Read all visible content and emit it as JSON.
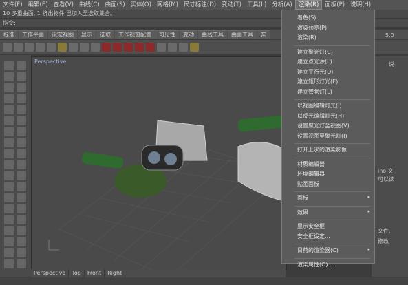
{
  "menubar": {
    "items": [
      {
        "label": "文件(F)"
      },
      {
        "label": "编辑(E)"
      },
      {
        "label": "查看(V)"
      },
      {
        "label": "曲线(C)"
      },
      {
        "label": "曲面(S)"
      },
      {
        "label": "实体(O)"
      },
      {
        "label": "网格(M)"
      },
      {
        "label": "尺寸标注(D)"
      },
      {
        "label": "变动(T)"
      },
      {
        "label": "工具(L)"
      },
      {
        "label": "分析(A)"
      },
      {
        "label": "渲染(R)",
        "active": true
      },
      {
        "label": "面板(P)"
      },
      {
        "label": "说明(H)"
      }
    ]
  },
  "command_history": "10 多重曲面, 1 挤出物件 已加入至选取集合。",
  "command_prompt": "指令:",
  "toolbar_tabs": [
    "标准",
    "工作平面",
    "设定视图",
    "显示",
    "选取",
    "工作视窗配置",
    "可见性",
    "变动",
    "曲线工具",
    "曲面工具",
    "实"
  ],
  "viewport": {
    "label": "Perspective"
  },
  "viewport_tabs": [
    "Perspective",
    "Top",
    "Front",
    "Right"
  ],
  "right_panel": {
    "tab_fragment": "说",
    "text_fragments": [
      "ino 文",
      "可以读",
      "文件,",
      "修改"
    ],
    "zoom": "5.0"
  },
  "render_menu": {
    "items": [
      {
        "label": "着色(S)"
      },
      {
        "label": "渲染预览(P)"
      },
      {
        "label": "渲染(R)"
      },
      {
        "separator": true
      },
      {
        "label": "建立聚光灯(C)"
      },
      {
        "label": "建立点光源(L)"
      },
      {
        "label": "建立平行光(D)"
      },
      {
        "label": "建立矩形灯光(E)"
      },
      {
        "label": "建立管状灯(L)"
      },
      {
        "separator": true
      },
      {
        "label": "以视图编辑灯光(I)"
      },
      {
        "label": "以反光编辑灯光(H)"
      },
      {
        "label": "设置聚光灯至视图(V)"
      },
      {
        "label": "设置视图至聚光灯(I)"
      },
      {
        "separator": true
      },
      {
        "label": "打开上次的渲染影像"
      },
      {
        "separator": true
      },
      {
        "label": "材质编辑器"
      },
      {
        "label": "环境编辑器"
      },
      {
        "label": "贴图面板"
      },
      {
        "separator": true
      },
      {
        "label": "面板",
        "submenu": true
      },
      {
        "separator": true
      },
      {
        "label": "效果",
        "submenu": true
      },
      {
        "separator": true
      },
      {
        "label": "显示安全框"
      },
      {
        "label": "安全框设定..."
      },
      {
        "separator": true
      },
      {
        "label": "目前的渲染器(C)",
        "submenu": true
      },
      {
        "separator": true
      },
      {
        "label": "渲染属性(O)..."
      }
    ]
  },
  "colors": {
    "overlay": "#3c3c3c",
    "pipe": "#2f6b2f",
    "object_white": "#bdbdbd"
  }
}
